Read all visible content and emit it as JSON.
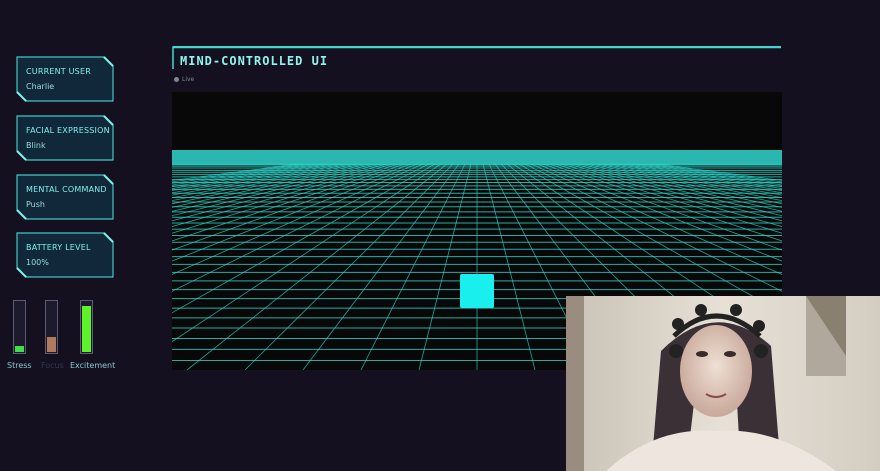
{
  "sidebar": {
    "cards": [
      {
        "label": "CURRENT USER",
        "value": "Charlie"
      },
      {
        "label": "FACIAL EXPRESSION",
        "value": "Blink"
      },
      {
        "label": "MENTAL COMMAND",
        "value": "Push"
      },
      {
        "label": "BATTERY LEVEL",
        "value": "100%"
      }
    ],
    "meters": [
      {
        "label": "Stress",
        "level": 0.12,
        "color": "#3ee04a",
        "label_color": "#8ac8d0"
      },
      {
        "label": "Focus",
        "level": 0.3,
        "color": "#b07a5e",
        "label_color": "#2e3a58"
      },
      {
        "label": "Excitement",
        "level": 0.92,
        "color": "#5ef22a",
        "label_color": "#8ac8d0"
      }
    ]
  },
  "main": {
    "title": "MIND-CONTROLLED UI",
    "status_label": "Live"
  },
  "scene": {
    "grid_color": "#2fd6cc",
    "cube_color": "#19f0ee"
  }
}
